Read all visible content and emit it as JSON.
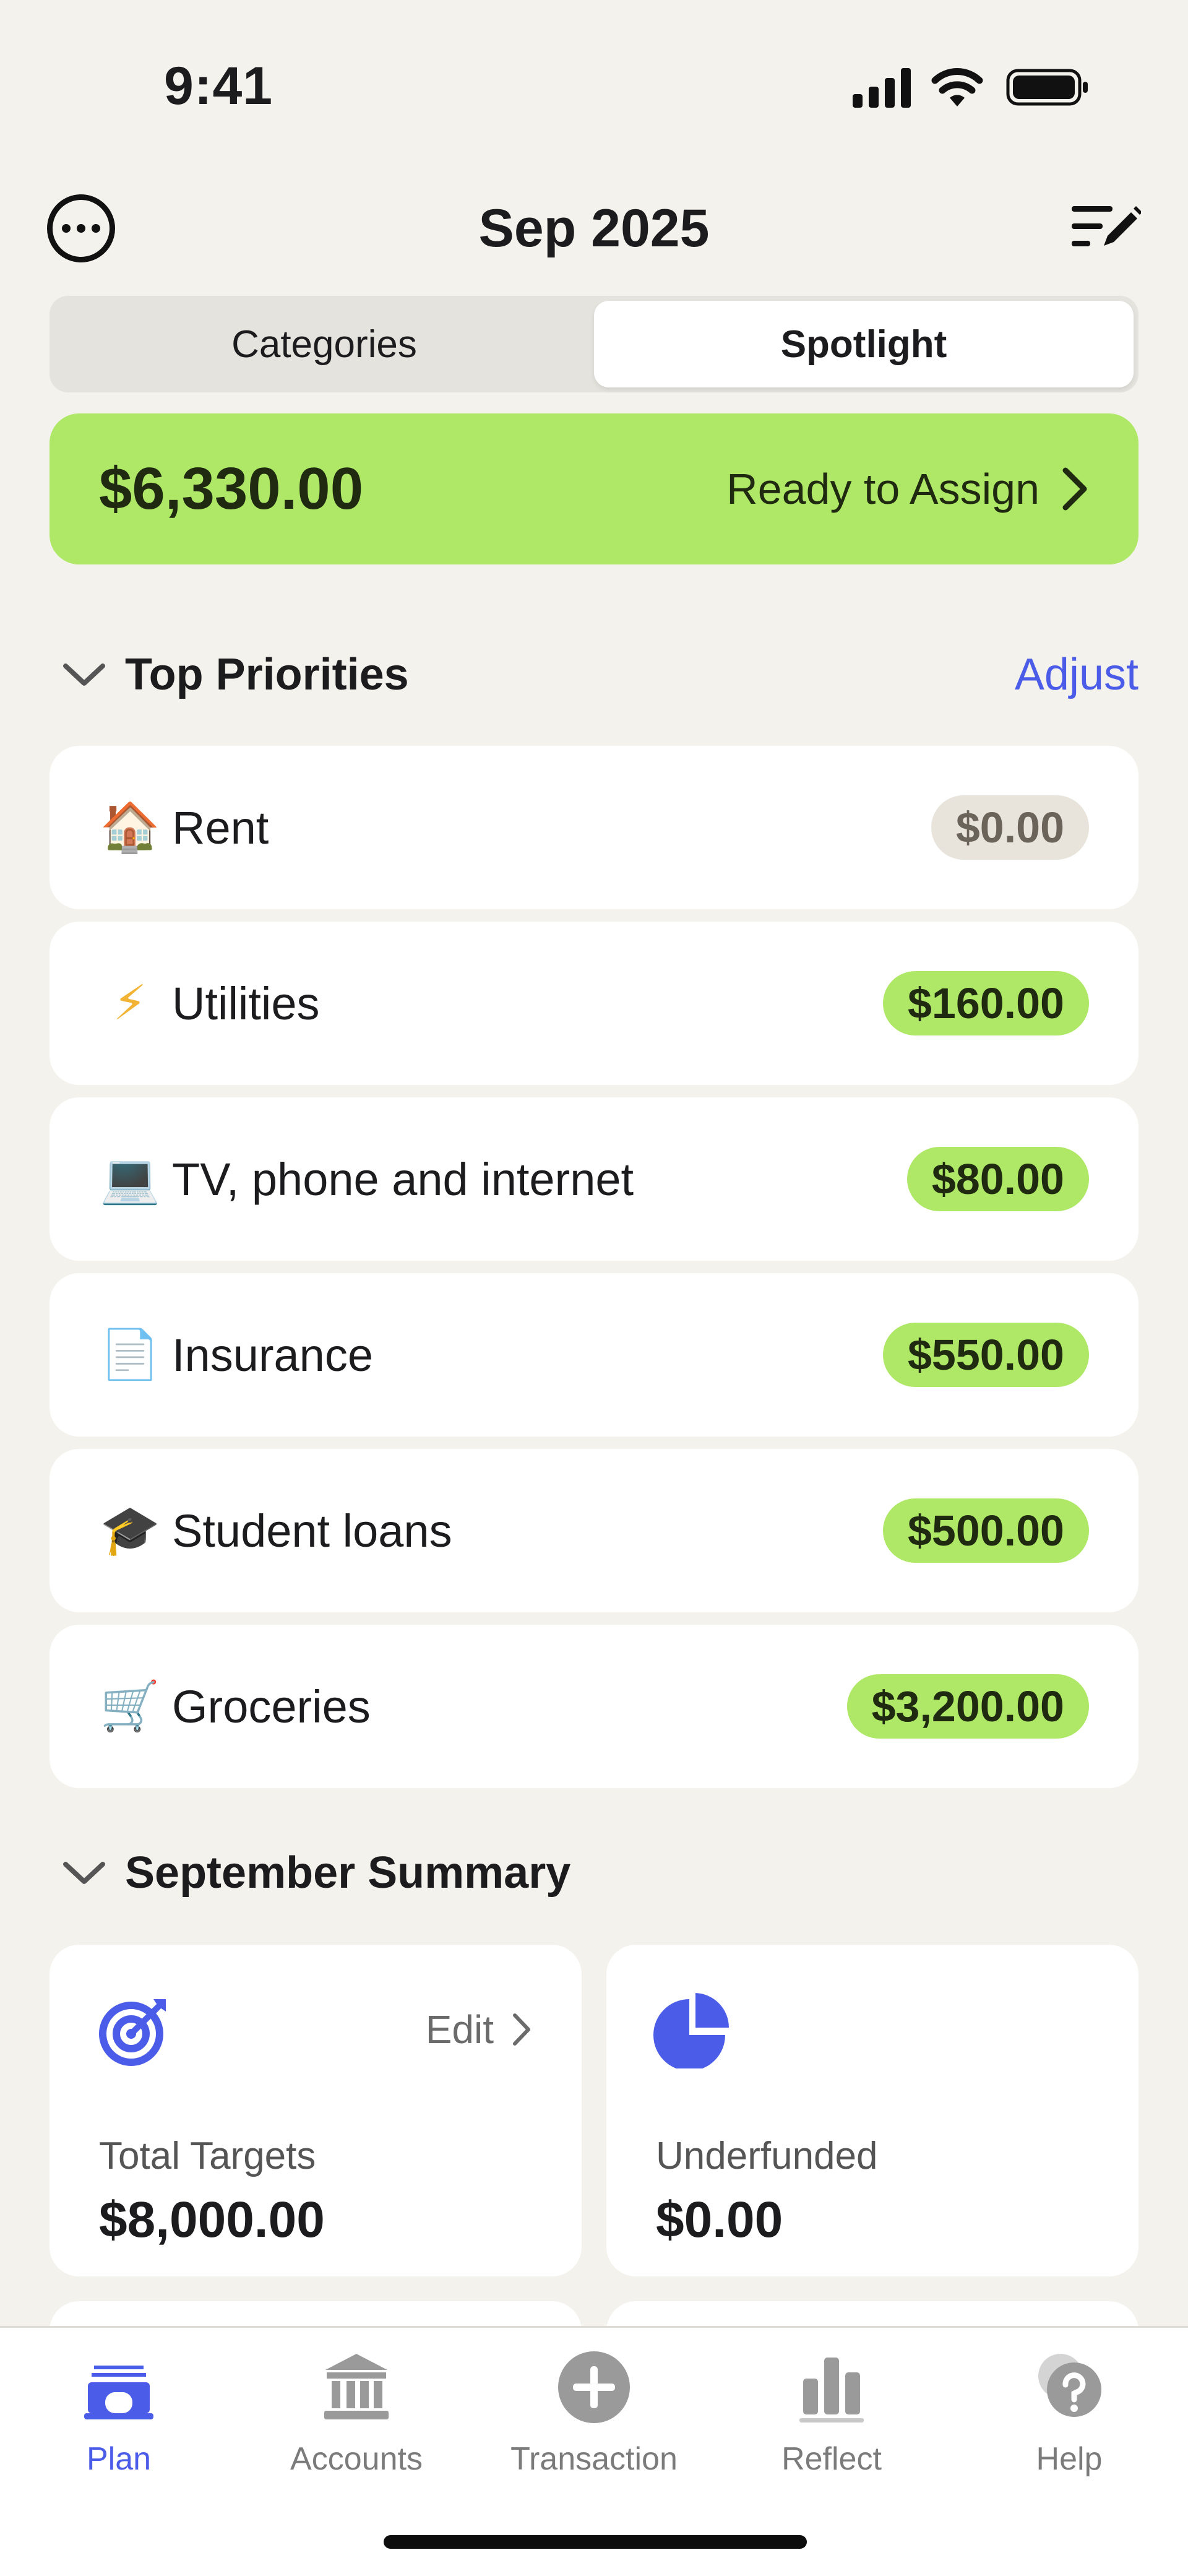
{
  "status_bar": {
    "time": "9:41"
  },
  "header": {
    "month": "Sep 2025"
  },
  "segments": [
    {
      "label": "Categories",
      "active": false
    },
    {
      "label": "Spotlight",
      "active": true
    }
  ],
  "ready_to_assign": {
    "amount": "$6,330.00",
    "label": "Ready to Assign"
  },
  "top_priorities": {
    "title": "Top Priorities",
    "adjust_label": "Adjust",
    "items": [
      {
        "icon": "house-icon",
        "emoji": "🏠",
        "name": "Rent",
        "amount": "$0.00",
        "funded": false
      },
      {
        "icon": "lightning-icon",
        "emoji": "⚡",
        "name": "Utilities",
        "amount": "$160.00",
        "funded": true
      },
      {
        "icon": "laptop-icon",
        "emoji": "💻",
        "name": "TV, phone and internet",
        "amount": "$80.00",
        "funded": true
      },
      {
        "icon": "document-icon",
        "emoji": "📄",
        "name": "Insurance",
        "amount": "$550.00",
        "funded": true
      },
      {
        "icon": "graduation-cap-icon",
        "emoji": "🎓",
        "name": "Student loans",
        "amount": "$500.00",
        "funded": true
      },
      {
        "icon": "shopping-cart-icon",
        "emoji": "🛒",
        "name": "Groceries",
        "amount": "$3,200.00",
        "funded": true
      }
    ]
  },
  "summary": {
    "title": "September Summary",
    "cards": [
      {
        "icon": "target-icon",
        "label": "Total Targets",
        "value": "$8,000.00",
        "edit_label": "Edit"
      },
      {
        "icon": "pie-chart-icon",
        "label": "Underfunded",
        "value": "$0.00"
      }
    ]
  },
  "tabs": [
    {
      "label": "Plan",
      "icon": "plan-icon",
      "active": true
    },
    {
      "label": "Accounts",
      "icon": "bank-icon",
      "active": false
    },
    {
      "label": "Transaction",
      "icon": "plus-circle-icon",
      "active": false
    },
    {
      "label": "Reflect",
      "icon": "bar-chart-icon",
      "active": false
    },
    {
      "label": "Help",
      "icon": "help-bubble-icon",
      "active": false
    }
  ],
  "colors": {
    "accent": "#4b5ce8",
    "funded_green": "#aee866",
    "background": "#f4f2ec"
  }
}
